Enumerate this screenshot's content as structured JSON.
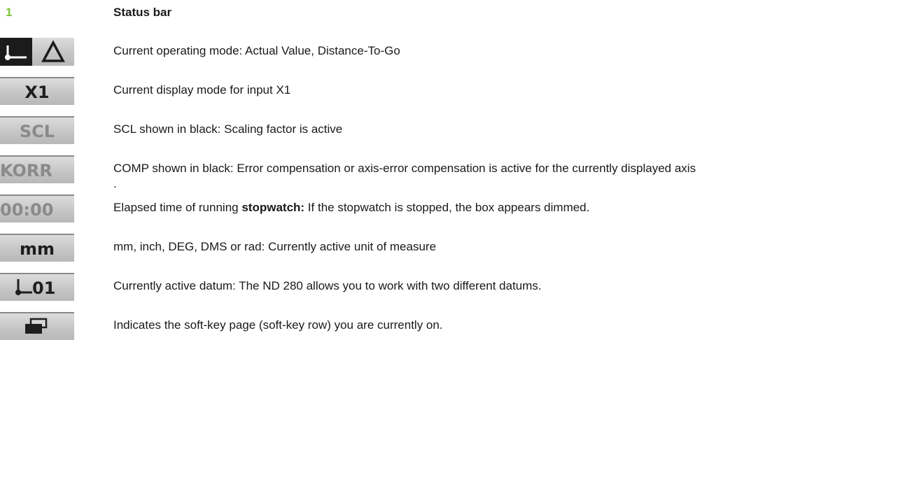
{
  "header": {
    "number": "1",
    "title": "Status bar"
  },
  "rows": [
    {
      "icon": "actual-value-distance-to-go-icon",
      "text": "Current operating mode: Actual Value, Distance-To-Go"
    },
    {
      "icon_label": "X1",
      "text": "Current display mode for input X1"
    },
    {
      "icon_label": "SCL",
      "text": "SCL shown in black: Scaling factor is active"
    },
    {
      "icon_label": "KORR",
      "text": "COMP shown in black: Error compensation or axis-error compensation is active for the currently displayed axis",
      "text_cont": "."
    },
    {
      "icon_label": "00:00",
      "text_before": "Elapsed time of running ",
      "text_bold": "stopwatch:",
      "text_after": " If the stopwatch is stopped, the box appears dimmed."
    },
    {
      "icon_label": "mm",
      "text": "mm, inch, DEG, DMS or rad: Currently active unit of measure"
    },
    {
      "icon_label": "01",
      "icon": "datum-icon",
      "text": "Currently active datum: The ND 280 allows you to work with two different datums."
    },
    {
      "icon": "soft-key-page-icon",
      "text": "Indicates the soft-key page (soft-key row) you are currently on."
    }
  ]
}
